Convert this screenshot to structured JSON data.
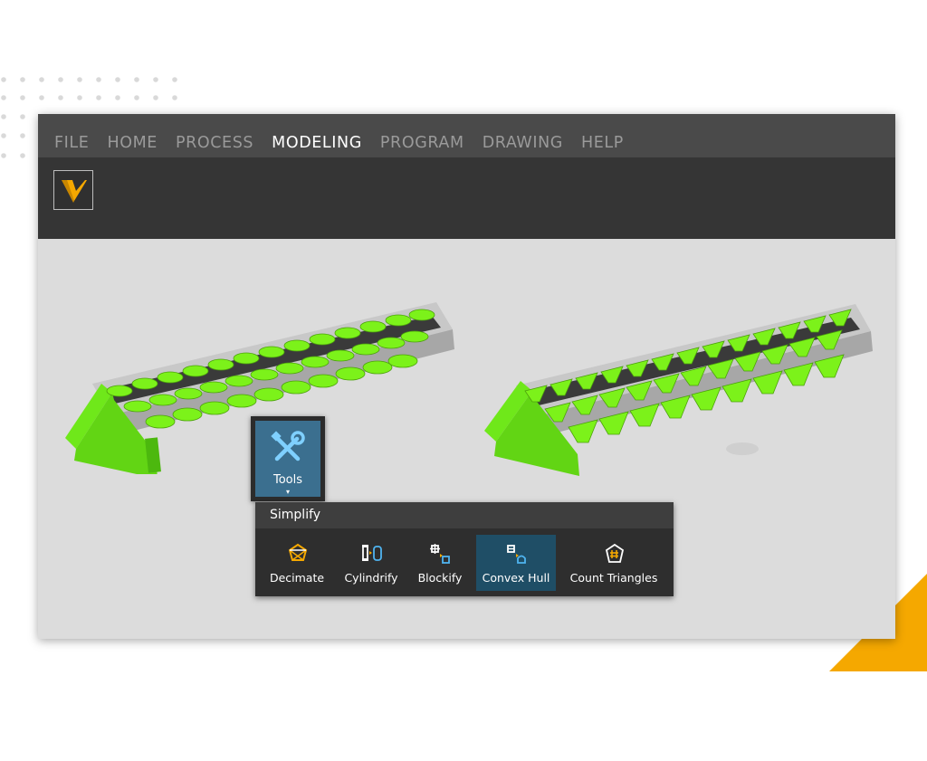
{
  "menu": {
    "items": [
      {
        "label": "FILE"
      },
      {
        "label": "HOME"
      },
      {
        "label": "PROCESS"
      },
      {
        "label": "MODELING",
        "active": true
      },
      {
        "label": "PROGRAM"
      },
      {
        "label": "DRAWING"
      },
      {
        "label": "HELP"
      }
    ]
  },
  "ribbon": {
    "tools_button": {
      "label": "Tools",
      "caret": "▾",
      "icon": "wrench-screwdriver-icon"
    }
  },
  "simplify_panel": {
    "title": "Simplify",
    "tools": [
      {
        "label": "Decimate",
        "icon": "decimate-icon"
      },
      {
        "label": "Cylindrify",
        "icon": "cylindrify-icon"
      },
      {
        "label": "Blockify",
        "icon": "blockify-icon"
      },
      {
        "label": "Convex Hull",
        "icon": "convex-hull-icon",
        "selected": true
      },
      {
        "label": "Count Triangles",
        "icon": "count-triangles-icon"
      }
    ]
  },
  "colors": {
    "accent_orange": "#F5A800",
    "part_green": "#7CF21A",
    "menu_bar": "#4A4A4A",
    "ribbon": "#353535",
    "tools_blue": "#3B6F8F",
    "selected_tool": "#1F4E66",
    "viewport": "#DCDCDC"
  }
}
